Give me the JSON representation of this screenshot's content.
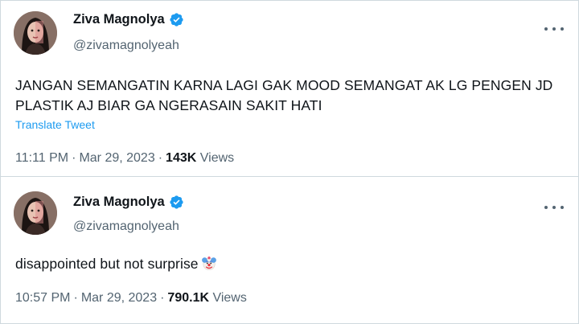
{
  "tweets": [
    {
      "display_name": "Ziva Magnolya",
      "handle": "@zivamagnolyeah",
      "text": "JANGAN SEMANGATIN KARNA LAGI GAK MOOD SEMANGAT AK LG PENGEN JD PLASTIK AJ BIAR GA NGERASAIN SAKIT HATI",
      "translate_label": "Translate Tweet",
      "time": "11:11 PM",
      "date": "Mar 29, 2023",
      "views_count": "143K",
      "views_label": "Views",
      "separator": "·"
    },
    {
      "display_name": "Ziva Magnolya",
      "handle": "@zivamagnolyeah",
      "text": "disappointed but not surprise",
      "emoji": "clown-face-icon",
      "time": "10:57 PM",
      "date": "Mar 29, 2023",
      "views_count": "790.1K",
      "views_label": "Views",
      "separator": "·"
    }
  ],
  "colors": {
    "verified_blue": "#1d9bf0",
    "secondary_text": "#536471",
    "link": "#1d9bf0",
    "border": "#cfd9de"
  }
}
